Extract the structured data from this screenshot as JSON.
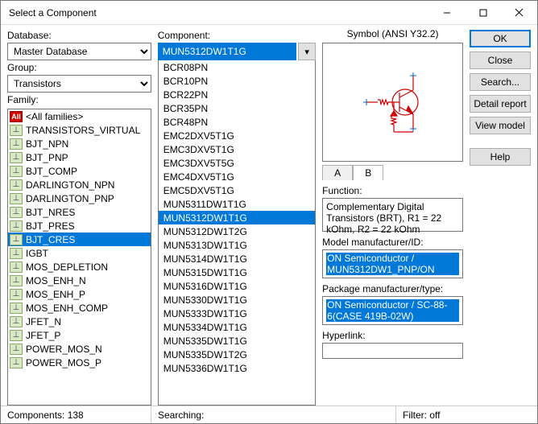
{
  "window": {
    "title": "Select a Component"
  },
  "labels": {
    "database": "Database:",
    "group": "Group:",
    "family": "Family:",
    "component": "Component:",
    "symbol_title": "Symbol (ANSI Y32.2)",
    "function": "Function:",
    "model_mfr": "Model manufacturer/ID:",
    "pkg_mfr": "Package manufacturer/type:",
    "hyperlink": "Hyperlink:"
  },
  "combos": {
    "database": "Master Database",
    "group": "Transistors"
  },
  "families": [
    {
      "icon": "all",
      "label": "<All families>"
    },
    {
      "icon": "sym",
      "label": "TRANSISTORS_VIRTUAL"
    },
    {
      "icon": "sym",
      "label": "BJT_NPN"
    },
    {
      "icon": "sym",
      "label": "BJT_PNP"
    },
    {
      "icon": "sym",
      "label": "BJT_COMP"
    },
    {
      "icon": "sym",
      "label": "DARLINGTON_NPN"
    },
    {
      "icon": "sym",
      "label": "DARLINGTON_PNP"
    },
    {
      "icon": "sym",
      "label": "BJT_NRES"
    },
    {
      "icon": "sym",
      "label": "BJT_PRES"
    },
    {
      "icon": "sym",
      "label": "BJT_CRES",
      "selected": true
    },
    {
      "icon": "sym",
      "label": "IGBT"
    },
    {
      "icon": "sym",
      "label": "MOS_DEPLETION"
    },
    {
      "icon": "sym",
      "label": "MOS_ENH_N"
    },
    {
      "icon": "sym",
      "label": "MOS_ENH_P"
    },
    {
      "icon": "sym",
      "label": "MOS_ENH_COMP"
    },
    {
      "icon": "sym",
      "label": "JFET_N"
    },
    {
      "icon": "sym",
      "label": "JFET_P"
    },
    {
      "icon": "sym",
      "label": "POWER_MOS_N"
    },
    {
      "icon": "sym",
      "label": "POWER_MOS_P"
    }
  ],
  "component_input": "MUN5312DW1T1G",
  "components": [
    "BCR08PN",
    "BCR10PN",
    "BCR22PN",
    "BCR35PN",
    "BCR48PN",
    "EMC2DXV5T1G",
    "EMC3DXV5T1G",
    "EMC3DXV5T5G",
    "EMC4DXV5T1G",
    "EMC5DXV5T1G",
    "MUN5311DW1T1G",
    "MUN5312DW1T1G",
    "MUN5312DW1T2G",
    "MUN5313DW1T1G",
    "MUN5314DW1T1G",
    "MUN5315DW1T1G",
    "MUN5316DW1T1G",
    "MUN5330DW1T1G",
    "MUN5333DW1T1G",
    "MUN5334DW1T1G",
    "MUN5335DW1T1G",
    "MUN5335DW1T2G",
    "MUN5336DW1T1G"
  ],
  "component_selected": "MUN5312DW1T1G",
  "tabs": {
    "a": "A",
    "b": "B"
  },
  "function_text": "Complementary Digital Transistors (BRT), R1 = 22 kOhm, R2 = 22 kOhm",
  "model_mfr_text": "ON Semiconductor / MUN5312DW1_PNP/ON",
  "pkg_mfr_text": "ON Semiconductor / SC-88-6(CASE 419B-02W)",
  "hyperlink_text": "",
  "buttons": {
    "ok": "OK",
    "close": "Close",
    "search": "Search...",
    "detail": "Detail report",
    "view": "View model",
    "help": "Help"
  },
  "status": {
    "components": "Components: 138",
    "searching": "Searching:",
    "filter": "Filter: off"
  }
}
